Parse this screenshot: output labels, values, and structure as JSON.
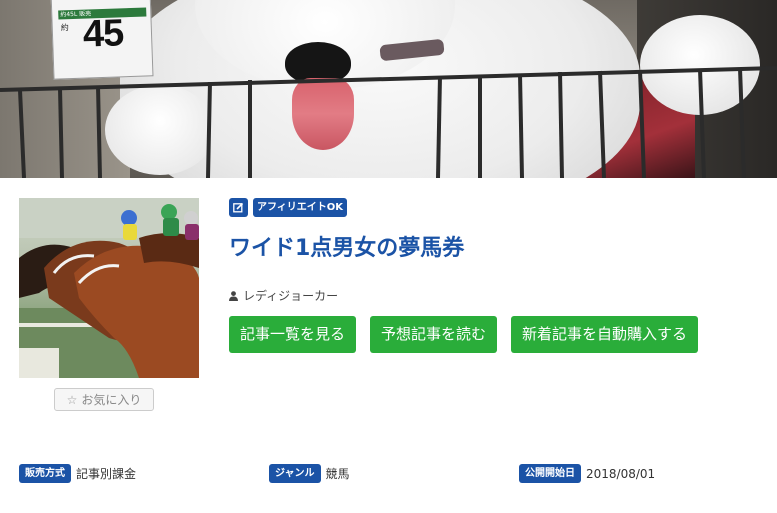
{
  "banner": {
    "sign_number": "45",
    "sign_top_text": "約45L 販売",
    "sign_small_text": "約"
  },
  "favorite": {
    "label": "お気に入り"
  },
  "badges": {
    "affiliate": "アフィリエイトOK"
  },
  "title": "ワイド1点男女の夢馬券",
  "author": "レディジョーカー",
  "actions": {
    "article_list": "記事一覧を見る",
    "read_prediction": "予想記事を読む",
    "auto_purchase": "新着記事を自動購入する"
  },
  "meta": {
    "sales_method_label": "販売方式",
    "sales_method_value": "記事別課金",
    "genre_label": "ジャンル",
    "genre_value": "競馬",
    "published_label": "公開開始日",
    "published_value": "2018/08/01"
  },
  "colors": {
    "accent": "#1b53a6",
    "action_green": "#2aad3a"
  }
}
